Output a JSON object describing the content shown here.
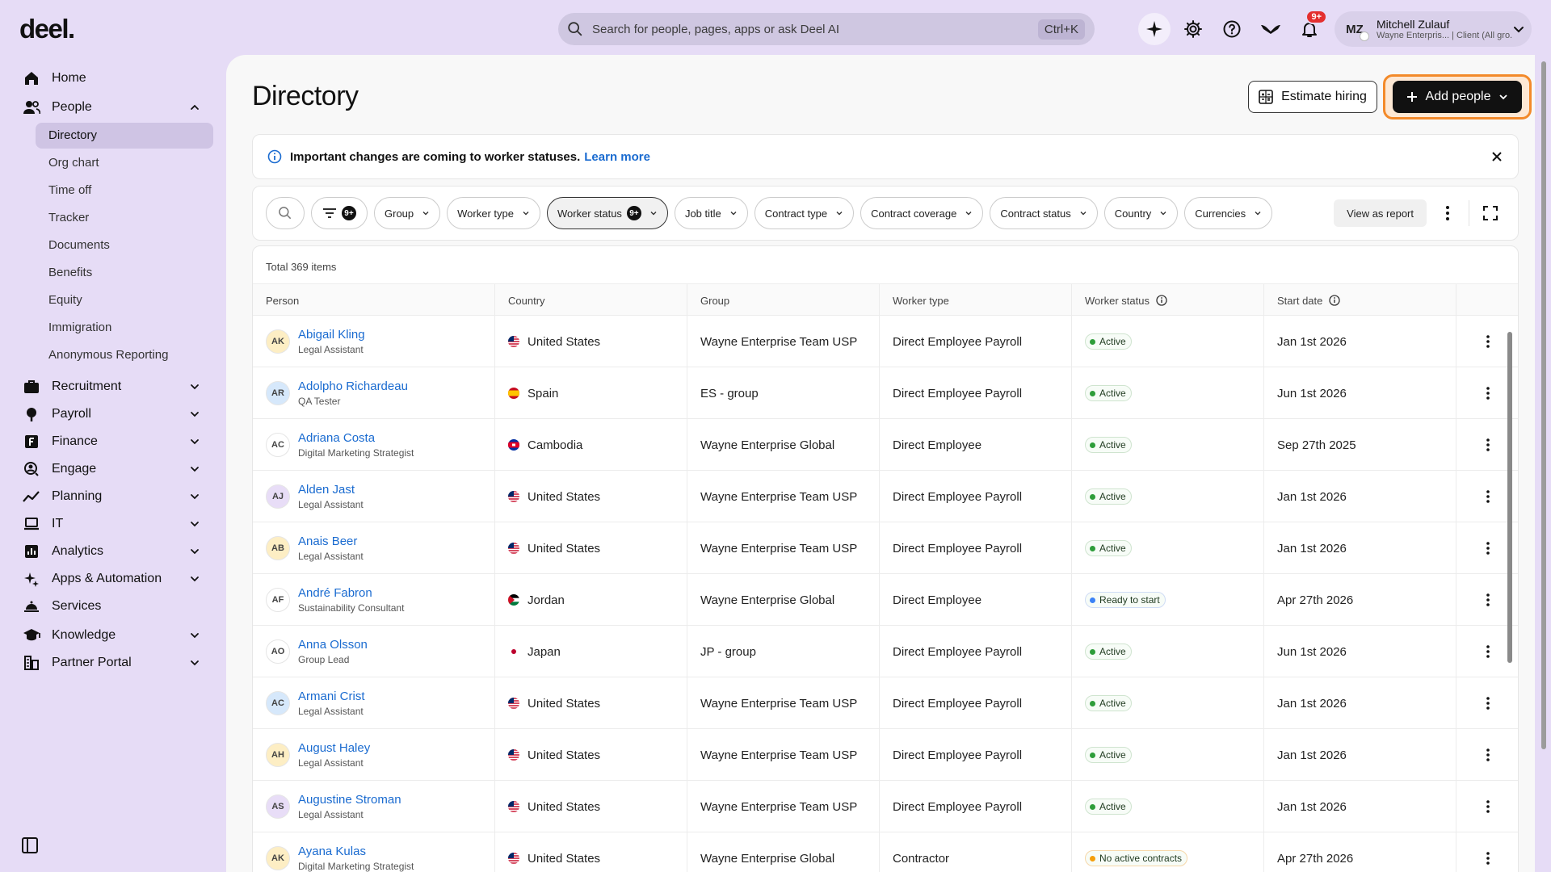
{
  "app": {
    "logo": "deel."
  },
  "search": {
    "placeholder": "Search for people, pages, apps or ask Deel AI",
    "shortcut": "Ctrl+K"
  },
  "top_icons": [
    "sparkle-icon",
    "gear-icon",
    "help-icon",
    "bird-icon",
    "bell-icon"
  ],
  "notifications": {
    "badge": "9+"
  },
  "profile": {
    "initials": "MZ",
    "name": "Mitchell Zulauf",
    "subtitle": "Wayne Enterpris... | Client (All gro..."
  },
  "sidebar": {
    "items": [
      {
        "label": "Home",
        "icon": "home-icon"
      },
      {
        "label": "People",
        "icon": "people-icon",
        "expanded": true,
        "children": [
          "Directory",
          "Org chart",
          "Time off",
          "Tracker",
          "Documents",
          "Benefits",
          "Equity",
          "Immigration",
          "Anonymous Reporting"
        ],
        "active_child": "Directory"
      },
      {
        "label": "Recruitment",
        "icon": "briefcase-icon"
      },
      {
        "label": "Payroll",
        "icon": "payroll-icon"
      },
      {
        "label": "Finance",
        "icon": "finance-icon"
      },
      {
        "label": "Engage",
        "icon": "engage-icon"
      },
      {
        "label": "Planning",
        "icon": "planning-icon"
      },
      {
        "label": "IT",
        "icon": "laptop-icon"
      },
      {
        "label": "Analytics",
        "icon": "analytics-icon"
      },
      {
        "label": "Apps & Automation",
        "icon": "apps-icon"
      },
      {
        "label": "Services",
        "icon": "services-icon"
      },
      {
        "label": "Knowledge",
        "icon": "knowledge-icon"
      },
      {
        "label": "Partner Portal",
        "icon": "partner-icon"
      }
    ]
  },
  "page": {
    "title": "Directory",
    "estimate_label": "Estimate hiring",
    "add_label": "Add people"
  },
  "banner": {
    "text": "Important changes are coming to worker statuses.",
    "link": "Learn more"
  },
  "filters": {
    "filter_count": "9+",
    "chips": [
      "Group",
      "Worker type",
      "Worker status",
      "Job title",
      "Contract type",
      "Contract coverage",
      "Contract status",
      "Country",
      "Currencies"
    ],
    "active_chip": "Worker status",
    "active_count": "9+",
    "report_label": "View as report"
  },
  "table": {
    "total": "Total 369 items",
    "headers": [
      "Person",
      "Country",
      "Group",
      "Worker type",
      "Worker status",
      "Start date"
    ],
    "rows": [
      {
        "initials": "AK",
        "avatar_color": "#fdeec4",
        "name": "Abigail Kling",
        "role": "Legal Assistant",
        "country": "United States",
        "flag": "us",
        "group": "Wayne Enterprise Team USP",
        "type": "Direct Employee Payroll",
        "status": "Active",
        "status_kind": "active",
        "start": "Jan 1st 2026"
      },
      {
        "initials": "AR",
        "avatar_color": "#d6e8fb",
        "name": "Adolpho Richardeau",
        "role": "QA Tester",
        "country": "Spain",
        "flag": "es",
        "group": "ES - group",
        "type": "Direct Employee Payroll",
        "status": "Active",
        "status_kind": "active",
        "start": "Jun 1st 2026"
      },
      {
        "initials": "AC",
        "avatar_color": "#ffffff",
        "name": "Adriana Costa",
        "role": "Digital Marketing Strategist",
        "country": "Cambodia",
        "flag": "kh",
        "group": "Wayne Enterprise Global",
        "type": "Direct Employee",
        "status": "Active",
        "status_kind": "active",
        "start": "Sep 27th 2025"
      },
      {
        "initials": "AJ",
        "avatar_color": "#e8ddf7",
        "name": "Alden Jast",
        "role": "Legal Assistant",
        "country": "United States",
        "flag": "us",
        "group": "Wayne Enterprise Team USP",
        "type": "Direct Employee Payroll",
        "status": "Active",
        "status_kind": "active",
        "start": "Jan 1st 2026"
      },
      {
        "initials": "AB",
        "avatar_color": "#fdeec4",
        "name": "Anais Beer",
        "role": "Legal Assistant",
        "country": "United States",
        "flag": "us",
        "group": "Wayne Enterprise Team USP",
        "type": "Direct Employee Payroll",
        "status": "Active",
        "status_kind": "active",
        "start": "Jan 1st 2026"
      },
      {
        "initials": "AF",
        "avatar_color": "#ffffff",
        "name": "André Fabron",
        "role": "Sustainability Consultant",
        "country": "Jordan",
        "flag": "jo",
        "group": "Wayne Enterprise Global",
        "type": "Direct Employee",
        "status": "Ready to start",
        "status_kind": "ready",
        "start": "Apr 27th 2026"
      },
      {
        "initials": "AO",
        "avatar_color": "#ffffff",
        "name": "Anna Olsson",
        "role": "Group Lead",
        "country": "Japan",
        "flag": "jp",
        "group": "JP - group",
        "type": "Direct Employee Payroll",
        "status": "Active",
        "status_kind": "active",
        "start": "Jun 1st 2026"
      },
      {
        "initials": "AC",
        "avatar_color": "#d6e8fb",
        "name": "Armani Crist",
        "role": "Legal Assistant",
        "country": "United States",
        "flag": "us",
        "group": "Wayne Enterprise Team USP",
        "type": "Direct Employee Payroll",
        "status": "Active",
        "status_kind": "active",
        "start": "Jan 1st 2026"
      },
      {
        "initials": "AH",
        "avatar_color": "#fdeec4",
        "name": "August Haley",
        "role": "Legal Assistant",
        "country": "United States",
        "flag": "us",
        "group": "Wayne Enterprise Team USP",
        "type": "Direct Employee Payroll",
        "status": "Active",
        "status_kind": "active",
        "start": "Jan 1st 2026"
      },
      {
        "initials": "AS",
        "avatar_color": "#e8ddf7",
        "name": "Augustine Stroman",
        "role": "Legal Assistant",
        "country": "United States",
        "flag": "us",
        "group": "Wayne Enterprise Team USP",
        "type": "Direct Employee Payroll",
        "status": "Active",
        "status_kind": "active",
        "start": "Jan 1st 2026"
      },
      {
        "initials": "AK",
        "avatar_color": "#fdeec4",
        "name": "Ayana Kulas",
        "role": "Digital Marketing Strategist",
        "country": "United States",
        "flag": "us",
        "group": "Wayne Enterprise Global",
        "type": "Contractor",
        "status": "No active contracts",
        "status_kind": "none",
        "start": "Apr 27th 2026"
      }
    ]
  },
  "colors": {
    "accent": "#1a6bd0",
    "sidebar_bg": "#e6dcf6",
    "add_btn": "#111111",
    "highlight": "#f38a2a",
    "active": "#2e9d3a",
    "ready": "#3b82f6",
    "none": "#f59e0b"
  }
}
